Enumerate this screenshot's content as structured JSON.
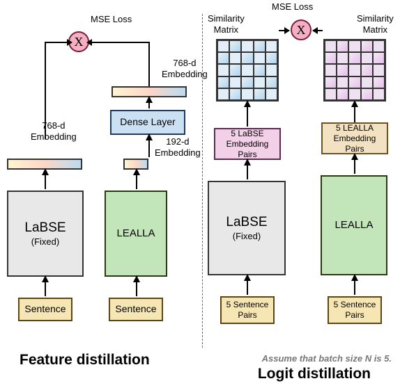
{
  "left": {
    "lossLabel": "MSE Loss",
    "lossSymbol": "X",
    "emb768": "768-d\nEmbedding",
    "emb768b": "768-d\nEmbedding",
    "emb192": "192-d\nEmbedding",
    "dense": "Dense Layer",
    "labse": "LaBSE",
    "labseSub": "(Fixed)",
    "lealla": "LEALLA",
    "sentenceL": "Sentence",
    "sentenceR": "Sentence",
    "title": "Feature distillation"
  },
  "right": {
    "lossLabel": "MSE Loss",
    "lossSymbol": "X",
    "simLeft": "Similarity\nMatrix",
    "simRight": "Similarity\nMatrix",
    "pairsL": "5 LaBSE\nEmbedding\nPairs",
    "pairsR": "5 LEALLA\nEmbedding\nPairs",
    "labse": "LaBSE",
    "labseSub": "(Fixed)",
    "lealla": "LEALLA",
    "sentenceL": "5 Sentence\nPairs",
    "sentenceR": "5 Sentence\nPairs",
    "assume": "Assume that batch size N is 5.",
    "title": "Logit distillation"
  }
}
